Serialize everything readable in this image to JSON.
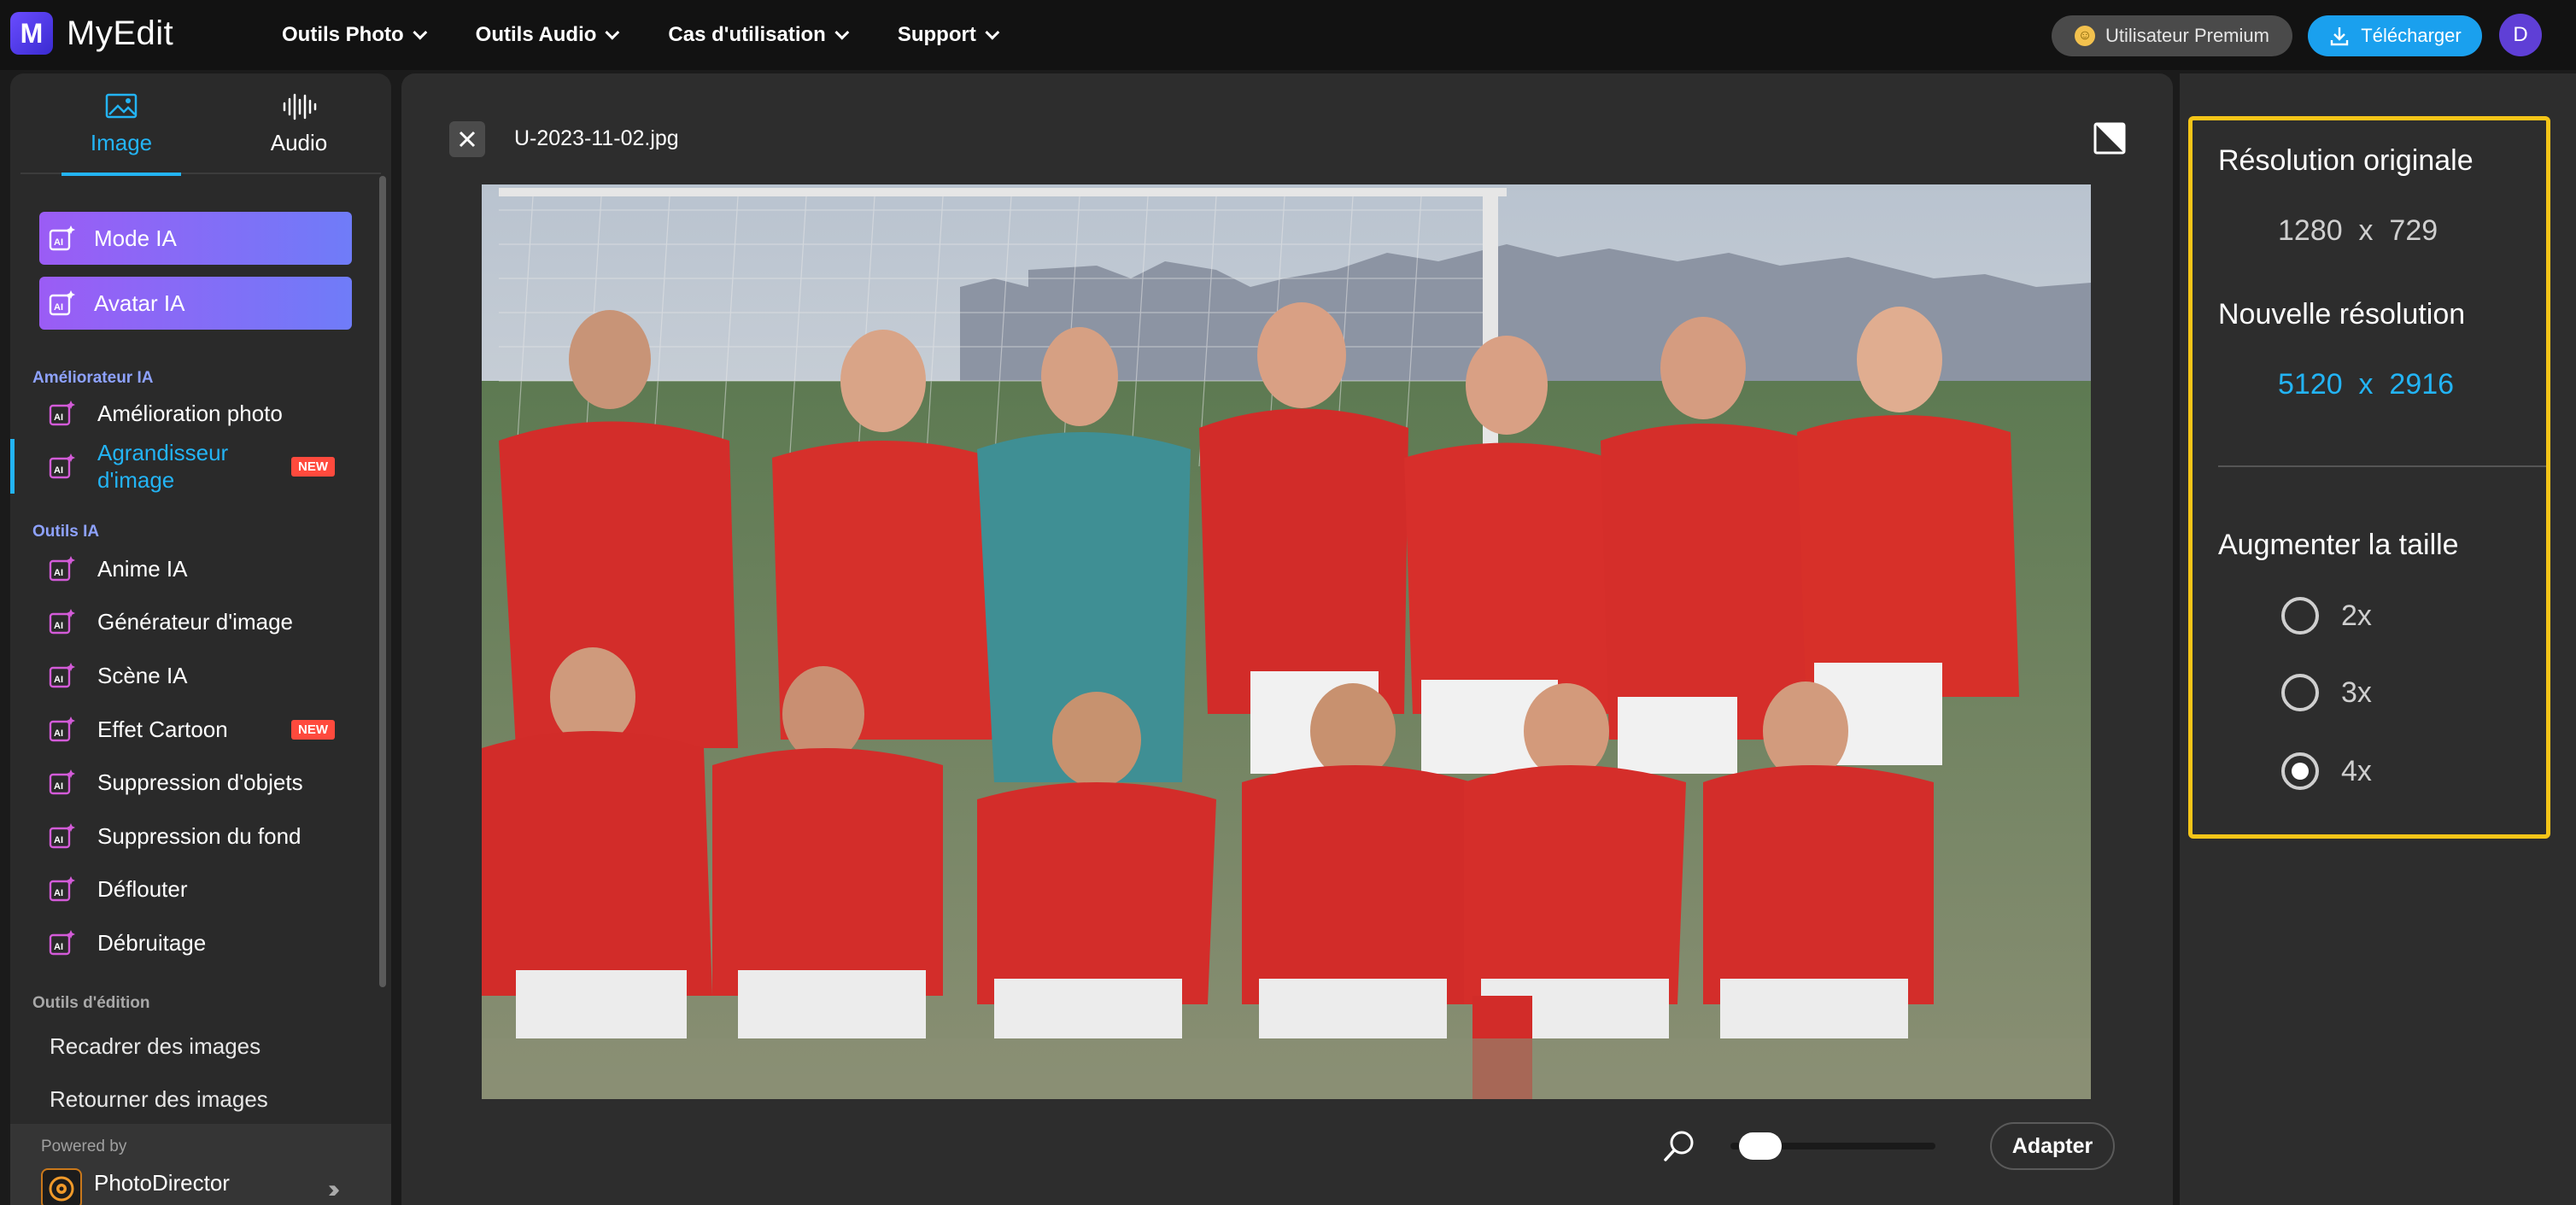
{
  "app": {
    "name": "MyEdit",
    "logo_letter": "M"
  },
  "nav": {
    "items": [
      {
        "label": "Outils Photo"
      },
      {
        "label": "Outils Audio"
      },
      {
        "label": "Cas d'utilisation"
      },
      {
        "label": "Support"
      }
    ],
    "premium_label": "Utilisateur Premium",
    "download_label": "Télécharger",
    "avatar_letter": "D"
  },
  "sidebar": {
    "tabs": [
      {
        "label": "Image",
        "active": true
      },
      {
        "label": "Audio",
        "active": false
      }
    ],
    "promo": [
      {
        "label": "Mode IA"
      },
      {
        "label": "Avatar IA"
      }
    ],
    "sections": {
      "enhancer": "Améliorateur IA",
      "ai_tools": "Outils IA",
      "edit_tools": "Outils d'édition"
    },
    "enhancer_items": [
      {
        "label": "Amélioration photo"
      },
      {
        "label": "Agrandisseur d'image",
        "badge": "NEW",
        "active": true
      }
    ],
    "ai_items": [
      {
        "label": "Anime IA"
      },
      {
        "label": "Générateur d'image"
      },
      {
        "label": "Scène IA"
      },
      {
        "label": "Effet Cartoon",
        "badge": "NEW"
      },
      {
        "label": "Suppression d'objets"
      },
      {
        "label": "Suppression du fond"
      },
      {
        "label": "Déflouter"
      },
      {
        "label": "Débruitage"
      }
    ],
    "edit_items": [
      {
        "label": "Recadrer des images"
      },
      {
        "label": "Retourner des images"
      }
    ],
    "powered": {
      "by": "Powered by",
      "name": "PhotoDirector"
    }
  },
  "canvas": {
    "file_name": "U-2023-11-02.jpg",
    "zoom_level": 0.05,
    "fit_label": "Adapter"
  },
  "panel": {
    "original_title": "Résolution originale",
    "original_value": "1280  x  729",
    "new_title": "Nouvelle résolution",
    "new_value": "5120  x  2916",
    "scale_title": "Augmenter la taille",
    "options": [
      {
        "label": "2x",
        "checked": false
      },
      {
        "label": "3x",
        "checked": false
      },
      {
        "label": "4x",
        "checked": true
      }
    ]
  },
  "colors": {
    "accent": "#23b4f5",
    "highlight_box": "#f5c518",
    "badge": "#ff4a3d"
  }
}
